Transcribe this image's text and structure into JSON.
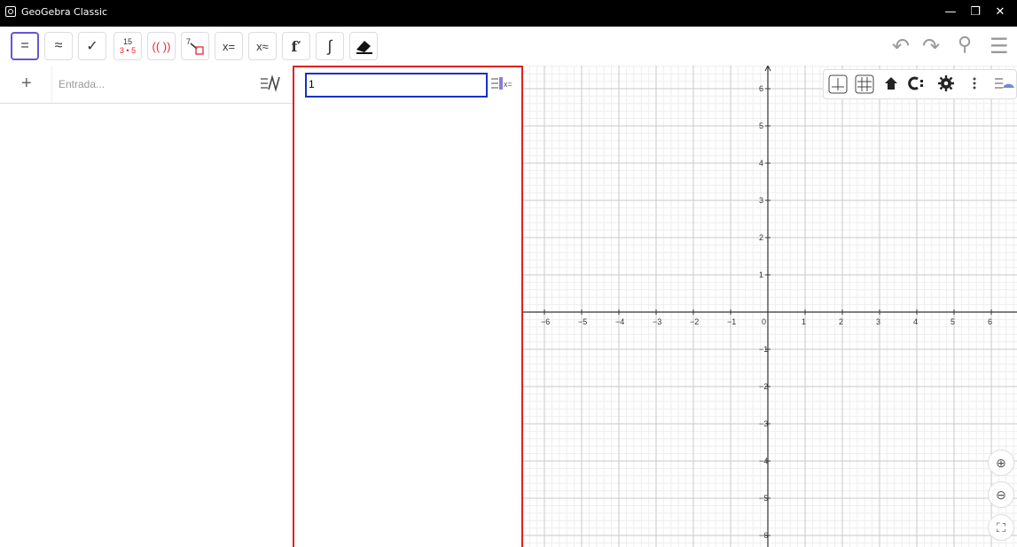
{
  "window": {
    "title": "GeoGebra Classic",
    "minimize": "—",
    "restore": "❐",
    "close": "✕"
  },
  "toolbar": {
    "buttons": [
      {
        "name": "equal-button",
        "label": "="
      },
      {
        "name": "approx-button",
        "label": "≈"
      },
      {
        "name": "check-button",
        "label": "✓"
      },
      {
        "name": "factor-button",
        "label": "15"
      },
      {
        "name": "expand-button",
        "label": "(( ))"
      },
      {
        "name": "substitute-button",
        "label": "7"
      },
      {
        "name": "solve-button",
        "label": "x="
      },
      {
        "name": "nsolve-button",
        "label": "x≈"
      },
      {
        "name": "derivative-button",
        "label": "f′"
      },
      {
        "name": "integral-button",
        "label": "∫"
      },
      {
        "name": "eraser-button",
        "label": ""
      }
    ],
    "factor_bottom": "3 • 5",
    "undo": "↶",
    "redo": "↷",
    "search": "⚲",
    "menu": "☰"
  },
  "algebra": {
    "add_label": "+",
    "input_placeholder": "Entrada...",
    "style_icon": "☰∕"
  },
  "cas": {
    "input_value": "1",
    "solve_icon": "x="
  },
  "graphics": {
    "style_bar": [
      "axes-icon",
      "grid-icon",
      "home-icon",
      "capture-icon",
      "settings-icon",
      "more-icon"
    ],
    "x_ticks": [
      "−6",
      "−5",
      "−4",
      "−3",
      "−2",
      "−1",
      "0",
      "1",
      "2",
      "3",
      "4",
      "5",
      "6"
    ],
    "y_ticks": [
      "6",
      "5",
      "4",
      "3",
      "2",
      "1",
      "−1",
      "−2",
      "−3",
      "−4",
      "−5",
      "−6"
    ],
    "zoom_in": "⊕",
    "zoom_out": "⊖",
    "fullscreen": "⛶"
  }
}
